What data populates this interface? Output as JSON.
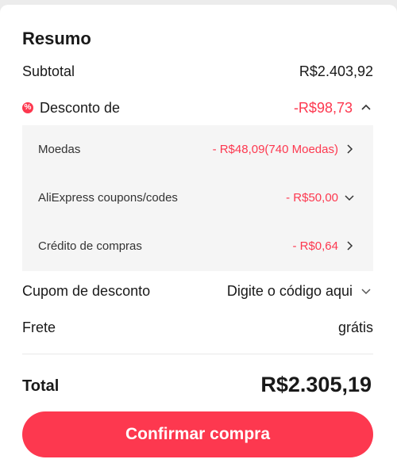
{
  "summary": {
    "title": "Resumo",
    "subtotal": {
      "label": "Subtotal",
      "value": "R$2.403,92"
    },
    "discount": {
      "label": "Desconto de",
      "value": "-R$98,73",
      "expanded": true,
      "items": [
        {
          "label": "Moedas",
          "value": "- R$48,09(740 Moedas)",
          "chevron": "chevron-right-icon"
        },
        {
          "label": "AliExpress coupons/codes",
          "value": "- R$50,00",
          "chevron": "chevron-down-icon"
        },
        {
          "label": "Crédito de compras",
          "value": "- R$0,64",
          "chevron": "chevron-right-icon"
        }
      ]
    },
    "coupon": {
      "label": "Cupom de desconto",
      "placeholder": "Digite o código aqui"
    },
    "shipping": {
      "label": "Frete",
      "value": "grátis"
    },
    "total": {
      "label": "Total",
      "value": "R$2.305,19"
    },
    "confirm_label": "Confirmar compra"
  },
  "colors": {
    "accent": "#fd384f",
    "panel": "#f5f5f5",
    "text": "#191919"
  }
}
